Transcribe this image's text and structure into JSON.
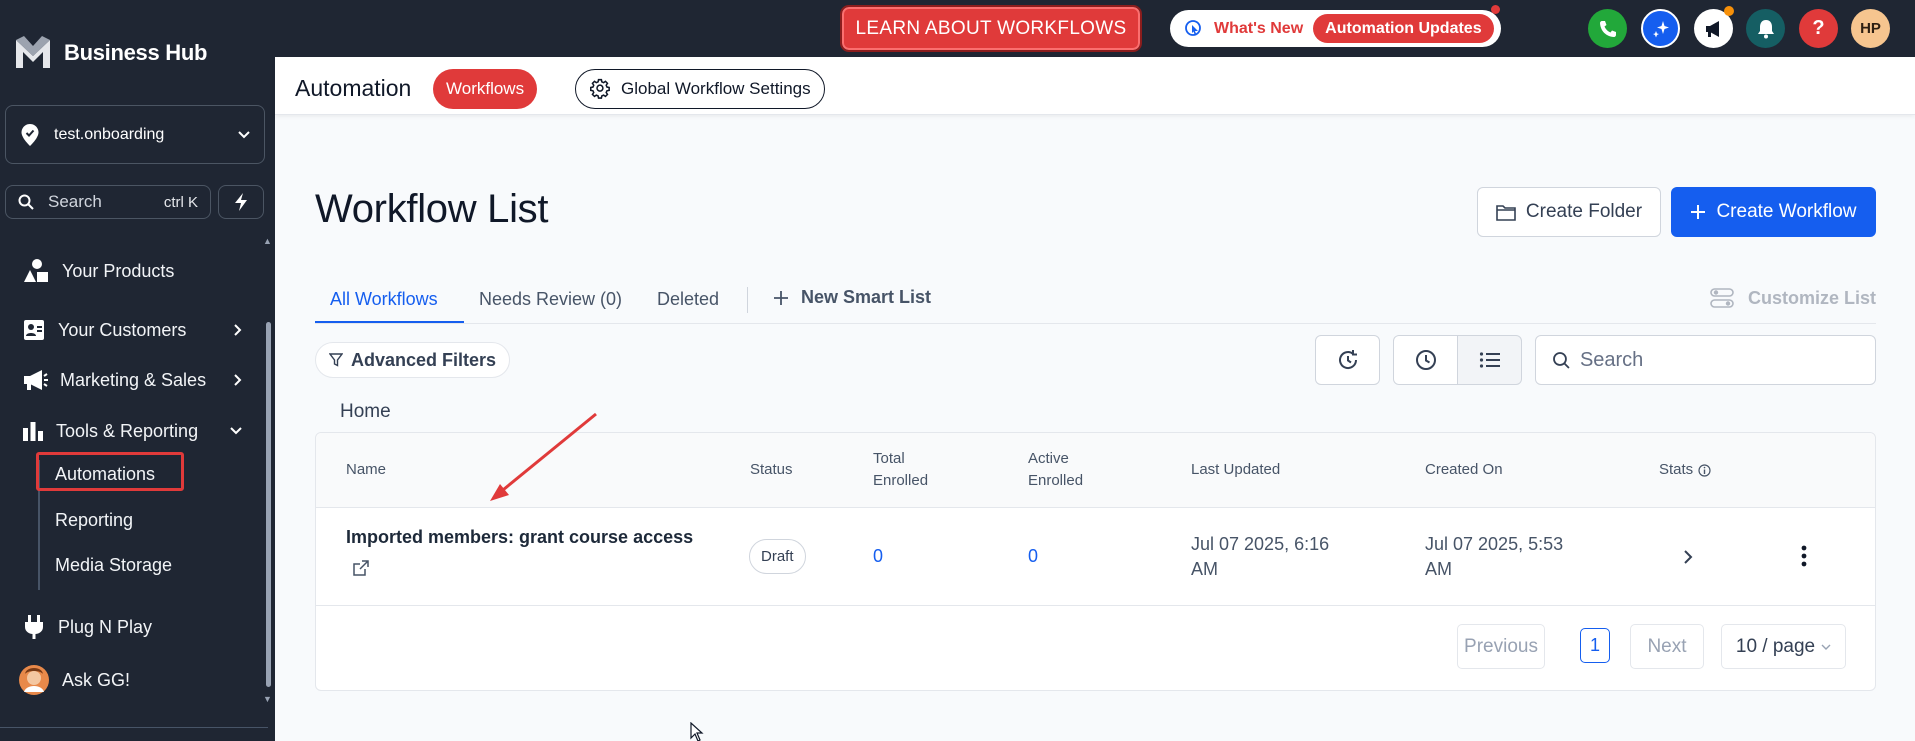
{
  "sidebar": {
    "brand": "Business Hub",
    "location": "test.onboarding",
    "search_label": "Search",
    "search_shortcut": "ctrl K",
    "nav": [
      {
        "label": "Your Products",
        "icon": "shapes-icon"
      },
      {
        "label": "Your Customers",
        "icon": "contact-card-icon"
      },
      {
        "label": "Marketing & Sales",
        "icon": "megaphone-icon"
      },
      {
        "label": "Tools & Reporting",
        "icon": "bar-chart-icon"
      }
    ],
    "sub_items": [
      "Automations",
      "Reporting",
      "Media Storage"
    ],
    "bottom_nav": [
      {
        "label": "Plug N Play",
        "icon": "plug-icon"
      },
      {
        "label": "Ask GG!",
        "icon": "avatar"
      }
    ]
  },
  "topbar": {
    "learn_button": "LEARN ABOUT WORKFLOWS",
    "whats_new": "What's New",
    "automation_updates": "Automation Updates",
    "avatar_initials": "HP",
    "colors": {
      "phone": "#22a83a",
      "ai": "#155eef",
      "bell": "#155e63",
      "help": "#e03a3a"
    }
  },
  "header": {
    "title": "Automation",
    "pill": "Workflows",
    "settings": "Global Workflow Settings"
  },
  "main": {
    "title": "Workflow List",
    "create_folder": "Create Folder",
    "create_workflow": "Create Workflow",
    "tabs": [
      "All Workflows",
      "Needs Review (0)",
      "Deleted"
    ],
    "new_smart_list": "New Smart List",
    "customize_list": "Customize List",
    "advanced_filters": "Advanced Filters",
    "search_placeholder": "Search",
    "breadcrumb": "Home",
    "columns": {
      "name": "Name",
      "status": "Status",
      "total_enrolled_1": "Total",
      "total_enrolled_2": "Enrolled",
      "active_enrolled_1": "Active",
      "active_enrolled_2": "Enrolled",
      "last_updated": "Last Updated",
      "created_on": "Created On",
      "stats": "Stats"
    },
    "rows": [
      {
        "name": "Imported members: grant course access",
        "status": "Draft",
        "total_enrolled": "0",
        "active_enrolled": "0",
        "last_updated_1": "Jul 07 2025, 6:16",
        "last_updated_2": "AM",
        "created_on_1": "Jul 07 2025, 5:53",
        "created_on_2": "AM"
      }
    ],
    "pagination": {
      "previous": "Previous",
      "current": "1",
      "next": "Next",
      "page_size": "10 / page"
    }
  },
  "colors": {
    "sidebar_bg": "#1f2633",
    "accent_red": "#e03a3a",
    "primary_blue": "#155eef"
  }
}
